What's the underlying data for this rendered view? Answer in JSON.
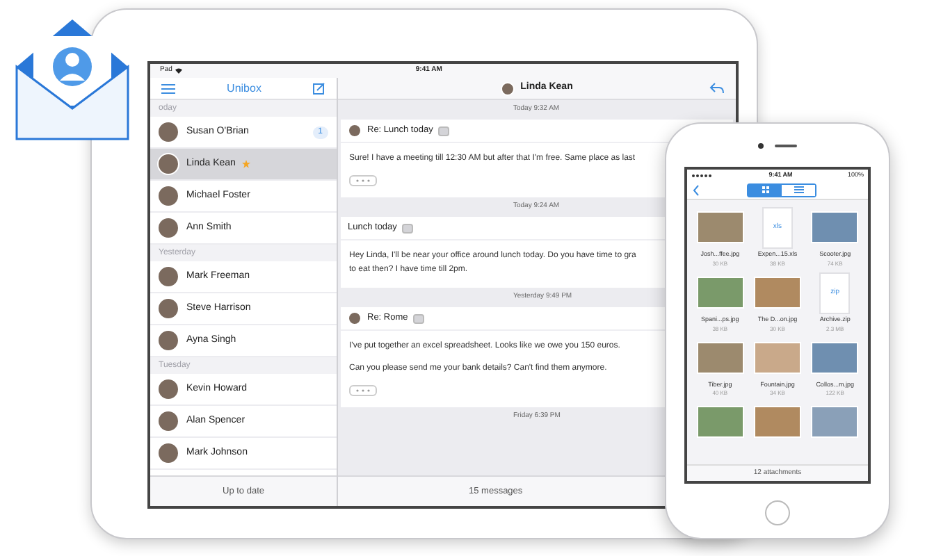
{
  "tablet": {
    "status_bar": {
      "device": "Pad",
      "time": "9:41 AM"
    },
    "sidebar": {
      "title": "Unibox",
      "footer": "Up to date",
      "items": [
        {
          "kind": "section",
          "label": "oday"
        },
        {
          "kind": "contact",
          "name": "Susan O'Brian",
          "badge": "1",
          "selected": false,
          "flagged": false
        },
        {
          "kind": "contact",
          "name": "Linda Kean",
          "selected": true,
          "flagged": true
        },
        {
          "kind": "contact",
          "name": "Michael Foster",
          "selected": false,
          "flagged": false
        },
        {
          "kind": "contact",
          "name": "Ann Smith",
          "selected": false,
          "flagged": false
        },
        {
          "kind": "section",
          "label": "Yesterday"
        },
        {
          "kind": "contact",
          "name": "Mark Freeman",
          "selected": false,
          "flagged": false
        },
        {
          "kind": "contact",
          "name": "Steve Harrison",
          "selected": false,
          "flagged": false
        },
        {
          "kind": "contact",
          "name": "Ayna Singh",
          "selected": false,
          "flagged": false
        },
        {
          "kind": "section",
          "label": "Tuesday"
        },
        {
          "kind": "contact",
          "name": "Kevin Howard",
          "selected": false,
          "flagged": false
        },
        {
          "kind": "contact",
          "name": "Alan Spencer",
          "selected": false,
          "flagged": false
        },
        {
          "kind": "contact",
          "name": "Mark Johnson",
          "selected": false,
          "flagged": false
        }
      ]
    },
    "conversation": {
      "title": "Linda Kean",
      "footer": "15 messages",
      "items": [
        {
          "kind": "separator",
          "label": "Today 9:32 AM"
        },
        {
          "kind": "message",
          "avatar": true,
          "subject": "Re: Lunch today",
          "paragraphs": [
            [
              "Sure! I have a meeting till 12:30 AM but after that I'm free. Same place as last"
            ]
          ],
          "more": true
        },
        {
          "kind": "separator",
          "label": "Today 9:24 AM"
        },
        {
          "kind": "message",
          "avatar": false,
          "subject": "Lunch today",
          "paragraphs": [
            [
              "Hey Linda, I'll be near your office around lunch today. Do you have time to gra",
              "to eat then? I have time till 2pm."
            ]
          ],
          "more": false
        },
        {
          "kind": "separator",
          "label": "Yesterday 9:49 PM"
        },
        {
          "kind": "message",
          "avatar": true,
          "subject": "Re: Rome",
          "paragraphs": [
            [
              "I've put together an excel spreadsheet. Looks like we owe you 150 euros."
            ],
            [
              "Can you please send me your bank details? Can't find them anymore."
            ]
          ],
          "more": true
        },
        {
          "kind": "separator",
          "label": "Friday 6:39 PM"
        }
      ]
    }
  },
  "phone": {
    "status_bar": {
      "time": "9:41 AM",
      "battery": "100%"
    },
    "view_tabs": [
      {
        "kind": "grid",
        "selected": true
      },
      {
        "kind": "list",
        "selected": false
      }
    ],
    "files": [
      {
        "kind": "photo",
        "name": "Josh...ffee.jpg",
        "size": "30 KB"
      },
      {
        "kind": "document",
        "ext": "xls",
        "name": "Expen...15.xls",
        "size": "38 KB"
      },
      {
        "kind": "photo",
        "name": "Scooter.jpg",
        "size": "74 KB"
      },
      {
        "kind": "photo",
        "name": "Spani...ps.jpg",
        "size": "38 KB"
      },
      {
        "kind": "photo",
        "name": "The D...on.jpg",
        "size": "30 KB"
      },
      {
        "kind": "document",
        "ext": "zip",
        "name": "Archive.zip",
        "size": "2.3 MB"
      },
      {
        "kind": "photo",
        "name": "Tiber.jpg",
        "size": "40 KB"
      },
      {
        "kind": "photo",
        "name": "Fountain.jpg",
        "size": "34 KB"
      },
      {
        "kind": "photo",
        "name": "Collos...m.jpg",
        "size": "122 KB"
      },
      {
        "kind": "photo"
      },
      {
        "kind": "photo"
      },
      {
        "kind": "photo"
      }
    ],
    "footer": "12 attachments"
  }
}
